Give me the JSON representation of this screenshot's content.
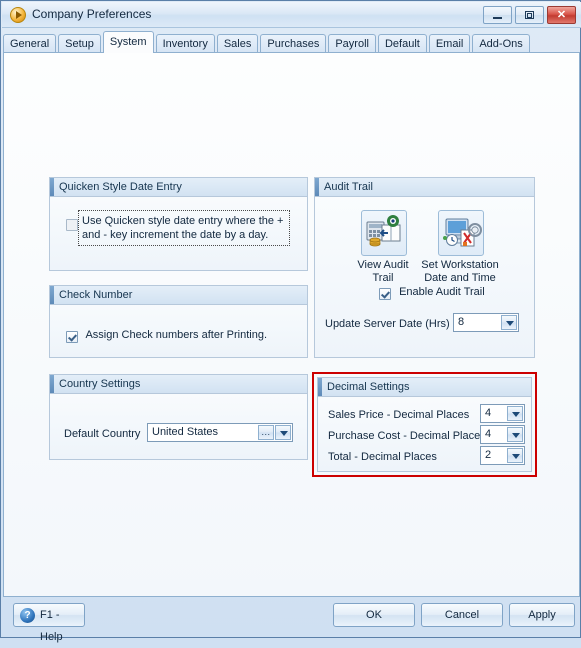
{
  "window": {
    "title": "Company Preferences",
    "app_icon": "play-circle-icon",
    "minimize_label": "Minimize",
    "maximize_label": "Maximize",
    "close_label": "Close",
    "close_glyph": "✕"
  },
  "tabs": [
    {
      "label": "General",
      "active": false
    },
    {
      "label": "Setup",
      "active": false
    },
    {
      "label": "System",
      "active": true
    },
    {
      "label": "Inventory",
      "active": false
    },
    {
      "label": "Sales",
      "active": false
    },
    {
      "label": "Purchases",
      "active": false
    },
    {
      "label": "Payroll",
      "active": false
    },
    {
      "label": "Default",
      "active": false
    },
    {
      "label": "Email",
      "active": false
    },
    {
      "label": "Add-Ons",
      "active": false
    }
  ],
  "groups": {
    "quicken": {
      "title": "Quicken Style Date Entry",
      "checkbox_label_line1": "Use Quicken style date entry where the +",
      "checkbox_label_line2": "and - key increment the date by a day.",
      "checked": false
    },
    "check_number": {
      "title": "Check Number",
      "checkbox_label": "Assign Check numbers after Printing.",
      "checked": true
    },
    "country": {
      "title": "Country Settings",
      "field_label": "Default Country",
      "value": "United States",
      "ellipsis_label": "..."
    },
    "audit": {
      "title": "Audit Trail",
      "view_audit_icon": "audit-ledger-icon",
      "view_audit_caption_line1": "View Audit",
      "view_audit_caption_line2": "Trail",
      "set_workstation_icon": "workstation-clock-icon",
      "set_workstation_caption_line1": "Set Workstation",
      "set_workstation_caption_line2": "Date and Time",
      "enable_label": "Enable Audit Trail",
      "enable_checked": true,
      "update_label": "Update Server Date (Hrs)",
      "update_value": "8"
    },
    "decimal": {
      "title": "Decimal Settings",
      "highlight_color": "#cc0000",
      "rows": [
        {
          "label": "Sales Price - Decimal Places",
          "value": "4"
        },
        {
          "label": "Purchase Cost - Decimal Places",
          "value": "4"
        },
        {
          "label": "Total - Decimal Places",
          "value": "2"
        }
      ]
    }
  },
  "footer": {
    "help_icon": "question-circle-icon",
    "help_glyph": "?",
    "help_label": "F1 - Help",
    "ok_label": "OK",
    "cancel_label": "Cancel",
    "apply_label": "Apply"
  }
}
